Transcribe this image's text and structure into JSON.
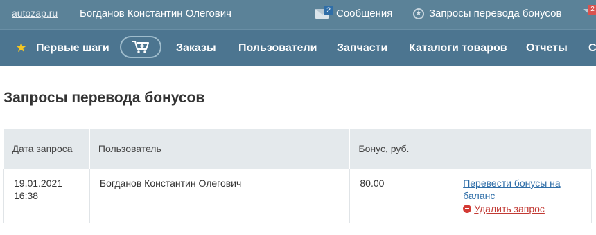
{
  "header": {
    "site": "autozap.ru",
    "user": "Богданов Константин Олегович",
    "messages_count": "2",
    "messages_label": "Сообщения",
    "requests_label": "Запросы перевода бонусов",
    "mail_badge": "2"
  },
  "nav": {
    "items": [
      "Первые шаги",
      "Заказы",
      "Пользователи",
      "Запчасти",
      "Каталоги товаров",
      "Отчеты",
      "С"
    ]
  },
  "page": {
    "title": "Запросы перевода бонусов"
  },
  "table": {
    "headers": [
      "Дата запроса",
      "Пользователь",
      "Бонус, руб.",
      ""
    ],
    "rows": [
      {
        "date": "19.01.2021",
        "time": "16:38",
        "user": "Богданов Константин Олегович",
        "bonus": "80.00",
        "transfer_label": "Перевести бонусы на баланс",
        "delete_label": "Удалить запрос"
      }
    ]
  },
  "colors": {
    "topbar": "#5b8298",
    "navbar": "#4c7590",
    "link": "#2f6ea8",
    "delete": "#c23a34",
    "star": "#f3c623"
  },
  "icons": [
    "envelope-icon",
    "star-circle-icon",
    "star-icon",
    "cart-plus-icon",
    "delete-icon"
  ]
}
